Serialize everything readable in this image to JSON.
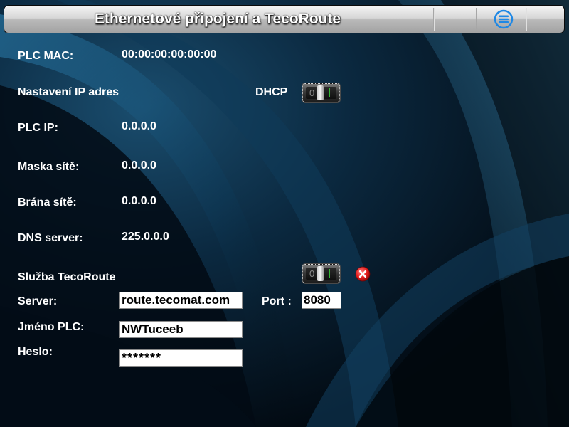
{
  "header": {
    "title": "Ethernetové připojení a TecoRoute",
    "menu_icon": "menu-list-icon"
  },
  "network": {
    "mac_label": "PLC MAC:",
    "mac_value": "00:00:00:00:00:00",
    "ip_settings_label": "Nastavení IP adres",
    "dhcp_label": "DHCP",
    "dhcp_enabled": false,
    "ip_label": "PLC IP:",
    "ip_value": "0.0.0.0",
    "mask_label": "Maska sítě:",
    "mask_value": "0.0.0.0",
    "gateway_label": "Brána sítě:",
    "gateway_value": "0.0.0.0",
    "dns_label": "DNS server:",
    "dns_value": "225.0.0.0"
  },
  "tecoroute": {
    "service_label": "Služba TecoRoute",
    "service_enabled": false,
    "status_icon": "error-x-icon",
    "server_label": "Server:",
    "server_value": "route.tecomat.com",
    "port_label": "Port :",
    "port_value": "8080",
    "plc_name_label": "Jméno PLC:",
    "plc_name_value": "NWTuceeb",
    "password_label": "Heslo:",
    "password_value": "*******"
  },
  "colors": {
    "background": "#03101c",
    "header_bar": "#c8c8c8",
    "menu_icon": "#1e88e5",
    "error_icon": "#e21b1b",
    "toggle_on": "#36b736"
  }
}
